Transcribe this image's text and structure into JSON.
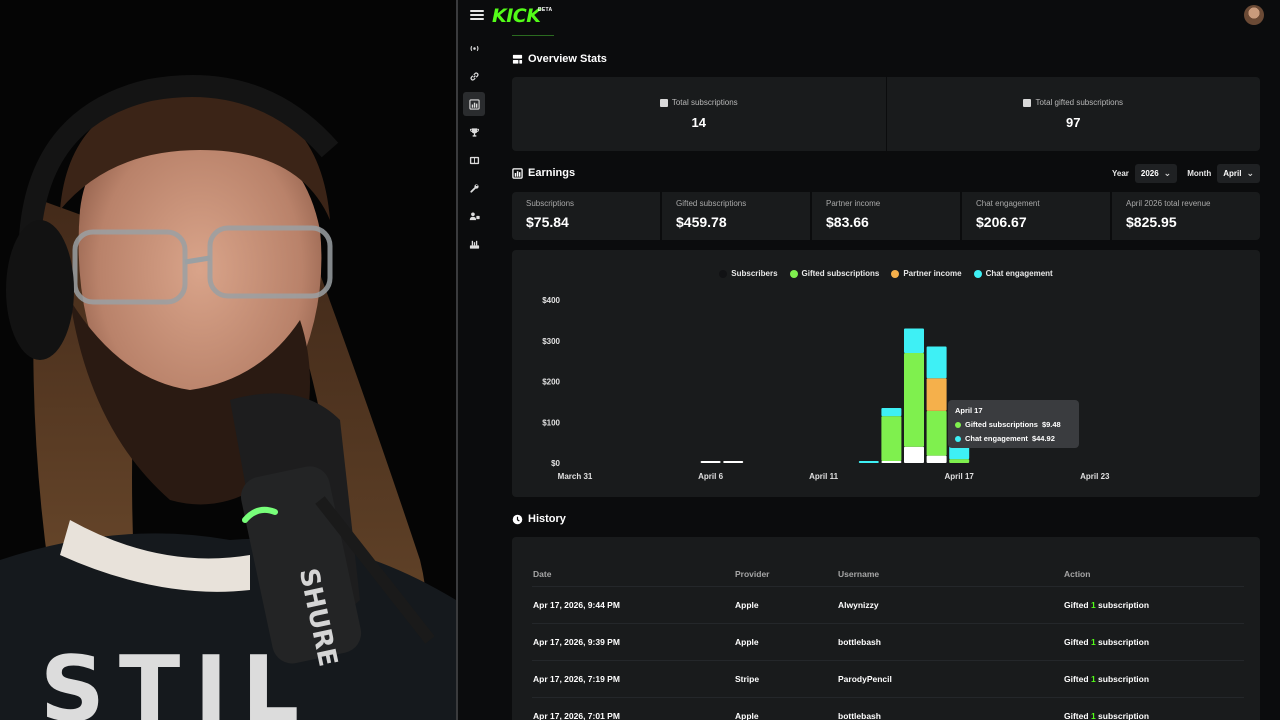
{
  "app": {
    "logo_text": "KICK",
    "logo_badge": "BETA",
    "brand_color": "#53fc18"
  },
  "sidebar": {
    "items": [
      {
        "icon": "broadcast-icon"
      },
      {
        "icon": "link-icon"
      },
      {
        "icon": "analytics-icon",
        "active": true
      },
      {
        "icon": "trophy-icon"
      },
      {
        "icon": "media-icon"
      },
      {
        "icon": "wrench-icon"
      },
      {
        "icon": "users-icon"
      },
      {
        "icon": "tools-icon"
      }
    ]
  },
  "overview": {
    "title": "Overview Stats",
    "stats": [
      {
        "label": "Total subscriptions",
        "value": "14"
      },
      {
        "label": "Total gifted subscriptions",
        "value": "97"
      }
    ]
  },
  "earnings": {
    "title": "Earnings",
    "year_label": "Year",
    "year_value": "2026",
    "month_label": "Month",
    "month_value": "April",
    "stats": [
      {
        "label": "Subscriptions",
        "value": "$75.84"
      },
      {
        "label": "Gifted subscriptions",
        "value": "$459.78"
      },
      {
        "label": "Partner income",
        "value": "$83.66"
      },
      {
        "label": "Chat engagement",
        "value": "$206.67"
      },
      {
        "label": "April 2026 total revenue",
        "value": "$825.95"
      }
    ]
  },
  "chart_data": {
    "type": "bar",
    "stacked": true,
    "legend_position": "top-center",
    "ylim": [
      0,
      400
    ],
    "y_ticks": [
      "$400",
      "$300",
      "$200",
      "$100",
      "$0"
    ],
    "x_tick_labels": [
      "March 31",
      "April 6",
      "April 11",
      "April 17",
      "April 23"
    ],
    "colors": {
      "subscribers": "#ffffff",
      "gifted": "#7ff04e",
      "partner": "#f5b04b",
      "chat": "#3ef0f5"
    },
    "series": [
      {
        "name": "Subscribers",
        "color": "#111214"
      },
      {
        "name": "Gifted subscriptions",
        "color": "#7ff04e"
      },
      {
        "name": "Partner income",
        "color": "#f5b04b"
      },
      {
        "name": "Chat engagement",
        "color": "#3ef0f5"
      }
    ],
    "bars": [
      {
        "day": "April 6",
        "subscribers": 5,
        "gifted": 0,
        "partner": 0,
        "chat": 0
      },
      {
        "day": "April 7",
        "subscribers": 5,
        "gifted": 0,
        "partner": 0,
        "chat": 0
      },
      {
        "day": "April 13",
        "subscribers": 0,
        "gifted": 0,
        "partner": 0,
        "chat": 5
      },
      {
        "day": "April 14",
        "subscribers": 5,
        "gifted": 110,
        "partner": 0,
        "chat": 20
      },
      {
        "day": "April 15",
        "subscribers": 40,
        "gifted": 230,
        "partner": 0,
        "chat": 60
      },
      {
        "day": "April 16",
        "subscribers": 18,
        "gifted": 110,
        "partner": 80,
        "chat": 78
      },
      {
        "day": "April 17",
        "subscribers": 0,
        "gifted": 9.48,
        "partner": 0,
        "chat": 44.92
      }
    ],
    "tooltip": {
      "title": "April 17",
      "rows": [
        {
          "label": "Gifted subscriptions",
          "value": "$9.48",
          "color": "#7ff04e"
        },
        {
          "label": "Chat engagement",
          "value": "$44.92",
          "color": "#3ef0f5"
        }
      ]
    }
  },
  "history": {
    "title": "History",
    "columns": [
      "Date",
      "Provider",
      "Username",
      "Action"
    ],
    "rows": [
      {
        "date": "Apr 17, 2026, 9:44 PM",
        "provider": "Apple",
        "username": "Alwynizzy",
        "action_pre": "Gifted",
        "action_count": "1",
        "action_post": "subscription"
      },
      {
        "date": "Apr 17, 2026, 9:39 PM",
        "provider": "Apple",
        "username": "bottlebash",
        "action_pre": "Gifted",
        "action_count": "1",
        "action_post": "subscription"
      },
      {
        "date": "Apr 17, 2026, 7:19 PM",
        "provider": "Stripe",
        "username": "ParodyPencil",
        "action_pre": "Gifted",
        "action_count": "1",
        "action_post": "subscription"
      },
      {
        "date": "Apr 17, 2026, 7:01 PM",
        "provider": "Apple",
        "username": "bottlebash",
        "action_pre": "Gifted",
        "action_count": "1",
        "action_post": "subscription"
      }
    ]
  }
}
